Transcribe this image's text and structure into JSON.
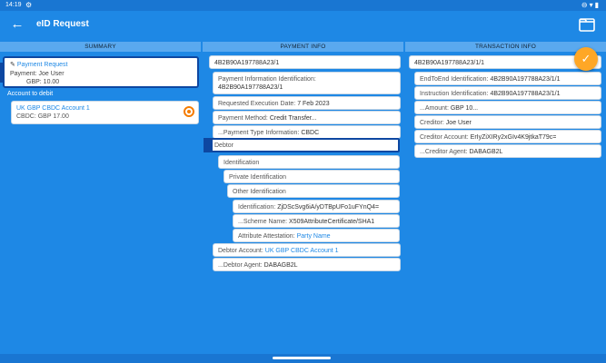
{
  "status_bar": {
    "time": "14:19"
  },
  "app_bar": {
    "title": "eID Request"
  },
  "columns": {
    "summary": "SUMMARY",
    "payment_info": "PAYMENT INFO",
    "transaction_info": "TRANSACTION INFO"
  },
  "summary": {
    "request_title": "Payment Request",
    "payment_line": "Payment: Joe User",
    "amount_line": "GBP: 10.00",
    "account_label": "Account to debit",
    "account_name": "UK GBP CBDC Account 1",
    "account_balance": "CBDC: GBP 17.00"
  },
  "payment_info": {
    "id": "4B2B90A197788A23/1",
    "payment_information_identification_label": "Payment Information Identification:",
    "payment_information_identification_value": "4B2B90A197788A23/1",
    "requested_execution_date_label": "Requested Execution Date:",
    "requested_execution_date_value": "7 Feb 2023",
    "payment_method_label": "Payment Method:",
    "payment_method_value": "Credit Transfer...",
    "payment_type_label": "...Payment Type Information:",
    "payment_type_value": "CBDC",
    "debtor_label": "Debtor",
    "identification_label": "Identification",
    "private_identification_label": "Private Identification",
    "other_identification_label": "Other Identification",
    "identification_value_label": "Identification:",
    "identification_value": "ZjDScSvg6iA/yDTBpUFo1uFYnQ4=",
    "scheme_name_label": "...Scheme Name:",
    "scheme_name_value": "X509AttributeCertificate/SHA1",
    "attribute_attestation_label": "Attribute Attestation:",
    "attribute_attestation_value": "Party Name",
    "debtor_account_label": "Debtor Account:",
    "debtor_account_value": "UK GBP CBDC Account 1",
    "debtor_agent_label": "...Debtor Agent:",
    "debtor_agent_value": "DABAGB2L"
  },
  "transaction_info": {
    "id": "4B2B90A197788A23/1/1",
    "end_to_end_label": "EndToEnd Identification:",
    "end_to_end_value": "4B2B90A197788A23/1/1",
    "instruction_label": "Instruction Identification:",
    "instruction_value": "4B2B90A197788A23/1/1",
    "amount_label": "...Amount:",
    "amount_value": "GBP 10...",
    "creditor_label": "Creditor:",
    "creditor_value": "Joe User",
    "creditor_account_label": "Creditor Account:",
    "creditor_account_value": "ErIyZiXIRy2xGIv4K9jtkaT79c=",
    "creditor_agent_label": "...Creditor Agent:",
    "creditor_agent_value": "DABAGB2L"
  }
}
